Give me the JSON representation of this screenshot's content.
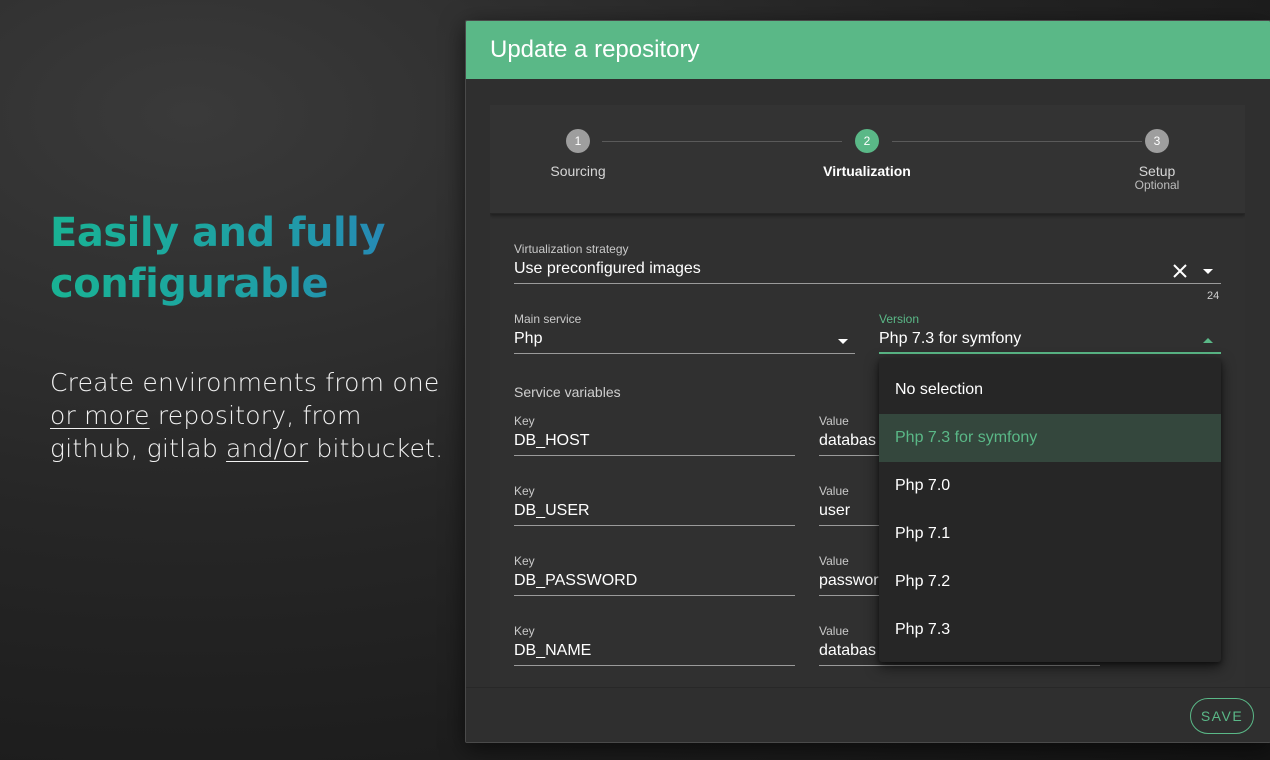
{
  "promo": {
    "headline_line1": "Easily and fully",
    "headline_line2": "configurable",
    "desc_part1": "Create environments from one ",
    "desc_u1": "or more",
    "desc_part2": " repository, from github, gitlab ",
    "desc_u2": "and/or",
    "desc_part3": " bitbucket."
  },
  "dialog": {
    "title": "Update a repository",
    "save_label": "SAVE"
  },
  "stepper": {
    "steps": [
      {
        "number": "1",
        "label": "Sourcing",
        "sublabel": ""
      },
      {
        "number": "2",
        "label": "Virtualization",
        "sublabel": ""
      },
      {
        "number": "3",
        "label": "Setup",
        "sublabel": "Optional"
      }
    ],
    "active_step": 2
  },
  "form": {
    "strategy": {
      "label": "Virtualization strategy",
      "value": "Use preconfigured images",
      "counter": "24"
    },
    "main_service": {
      "label": "Main service",
      "value": "Php"
    },
    "version": {
      "label": "Version",
      "value": "Php 7.3 for symfony"
    },
    "service_variables_label": "Service variables",
    "variables": [
      {
        "key_label": "Key",
        "key": "DB_HOST",
        "value_label": "Value",
        "value": "databas"
      },
      {
        "key_label": "Key",
        "key": "DB_USER",
        "value_label": "Value",
        "value": "user"
      },
      {
        "key_label": "Key",
        "key": "DB_PASSWORD",
        "value_label": "Value",
        "value": "passwor"
      },
      {
        "key_label": "Key",
        "key": "DB_NAME",
        "value_label": "Value",
        "value": "databas"
      }
    ]
  },
  "version_dropdown": {
    "options": [
      "No selection",
      "Php 7.3 for symfony",
      "Php 7.0",
      "Php 7.1",
      "Php 7.2",
      "Php 7.3"
    ],
    "selected": "Php 7.3 for symfony"
  },
  "colors": {
    "accent": "#5ab887",
    "headline_start": "#19b394",
    "headline_end": "#2a7dbd"
  }
}
